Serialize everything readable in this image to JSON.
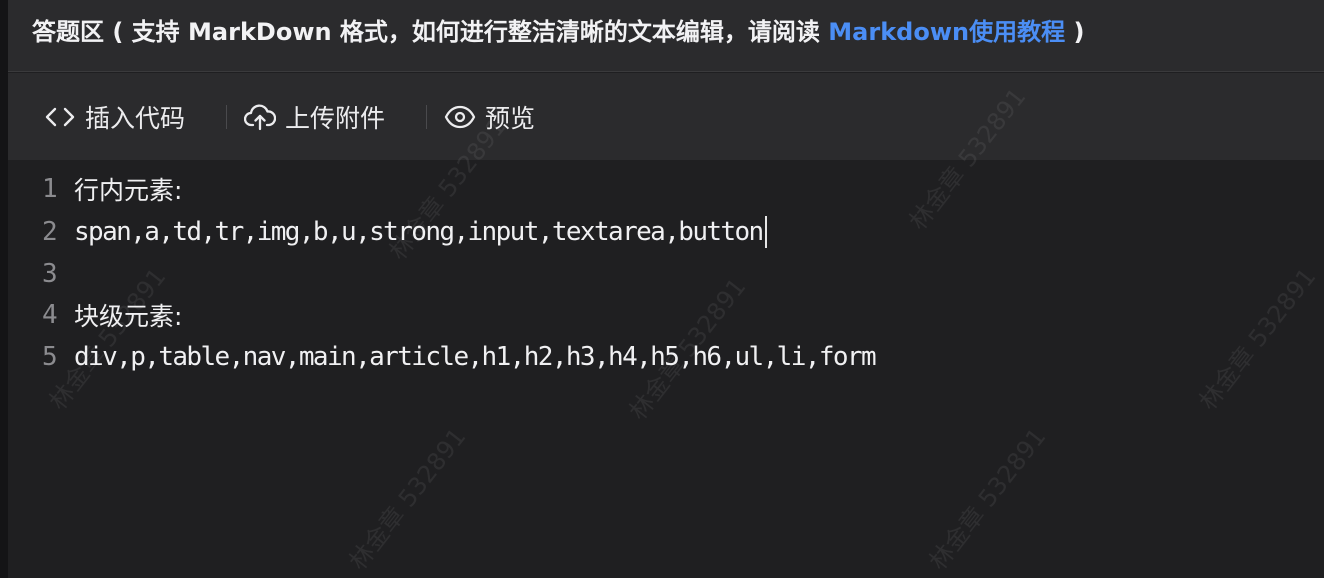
{
  "header": {
    "title_prefix": "答题区 ( 支持 MarkDown 格式，如何进行整洁清晰的文本编辑，请阅读 ",
    "link_text": "Markdown使用教程",
    "title_suffix": " )"
  },
  "toolbar": {
    "insert_code_label": "插入代码",
    "upload_label": "上传附件",
    "preview_label": "预览"
  },
  "editor": {
    "lines": [
      {
        "number": "1",
        "text": "行内元素:"
      },
      {
        "number": "2",
        "text": "span,a,td,tr,img,b,u,strong,input,textarea,button"
      },
      {
        "number": "3",
        "text": ""
      },
      {
        "number": "4",
        "text": "块级元素:"
      },
      {
        "number": "5",
        "text": "div,p,table,nav,main,article,h1,h2,h3,h4,h5,h6,ul,li,form"
      }
    ]
  },
  "watermark": {
    "text": "林金章 532891"
  },
  "colors": {
    "accent_link": "#4b8ef5",
    "background": "#1f1f21",
    "toolbar_bg": "#2b2b2d"
  }
}
